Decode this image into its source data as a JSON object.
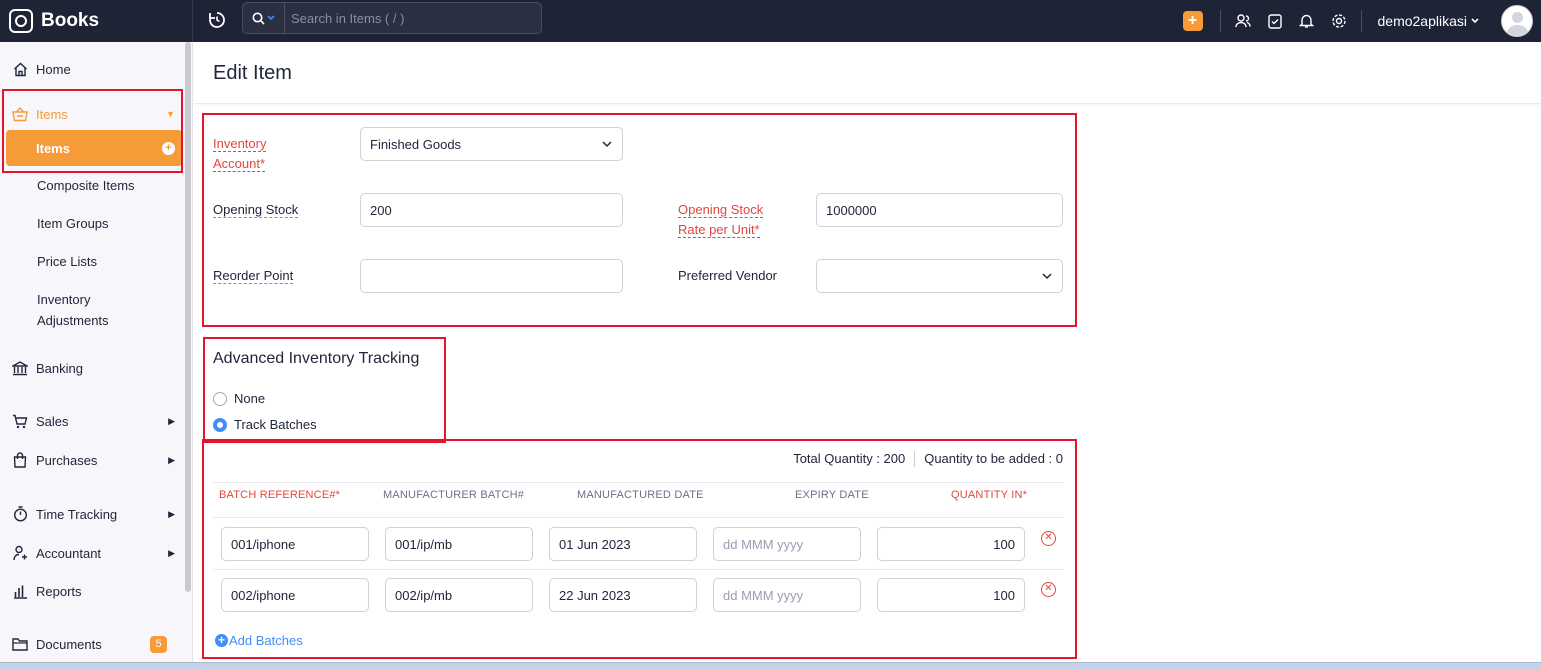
{
  "app": {
    "name": "Books"
  },
  "search": {
    "placeholder": "Search in Items ( / )"
  },
  "topbar": {
    "org_name": "demo2aplikasi"
  },
  "sidebar": {
    "home": "Home",
    "items_group": "Items",
    "items": "Items",
    "composite_items": "Composite Items",
    "item_groups": "Item Groups",
    "price_lists": "Price Lists",
    "inventory_adjustments_1": "Inventory",
    "inventory_adjustments_2": "Adjustments",
    "banking": "Banking",
    "sales": "Sales",
    "purchases": "Purchases",
    "time_tracking": "Time Tracking",
    "accountant": "Accountant",
    "reports": "Reports",
    "documents": "Documents",
    "documents_badge": "5"
  },
  "page": {
    "title": "Edit Item"
  },
  "form": {
    "inventory_account_label_1": "Inventory",
    "inventory_account_label_2": "Account*",
    "inventory_account_value": "Finished Goods",
    "opening_stock_label": "Opening Stock",
    "opening_stock_value": "200",
    "opening_rate_label_1": "Opening Stock",
    "opening_rate_label_2": "Rate per Unit*",
    "opening_rate_value": "1000000",
    "reorder_point_label": "Reorder Point",
    "reorder_point_value": "",
    "preferred_vendor_label": "Preferred Vendor",
    "preferred_vendor_value": ""
  },
  "tracking": {
    "title": "Advanced Inventory Tracking",
    "options": [
      {
        "label": "None",
        "selected": false
      },
      {
        "label": "Track Batches",
        "selected": true
      }
    ]
  },
  "batches": {
    "total_quantity": "Total Quantity : 200",
    "quantity_to_add": "Quantity to be added : 0",
    "headers": [
      "BATCH REFERENCE#*",
      "MANUFACTURER BATCH#",
      "MANUFACTURED DATE",
      "EXPIRY DATE",
      "QUANTITY IN*"
    ],
    "rows": [
      {
        "ref": "001/iphone",
        "mfr_batch": "001/ip/mb",
        "mfg_date": "01 Jun 2023",
        "expiry": "",
        "qty": "100"
      },
      {
        "ref": "002/iphone",
        "mfr_batch": "002/ip/mb",
        "mfg_date": "22 Jun 2023",
        "expiry": "",
        "qty": "100"
      }
    ],
    "date_placeholder": "dd MMM yyyy",
    "add_label": "Add Batches"
  },
  "colors": {
    "accent": "#f79a38",
    "topbar": "#1f2336",
    "link": "#408dfb",
    "required": "#e0473c",
    "highlight": "#e2152b"
  }
}
